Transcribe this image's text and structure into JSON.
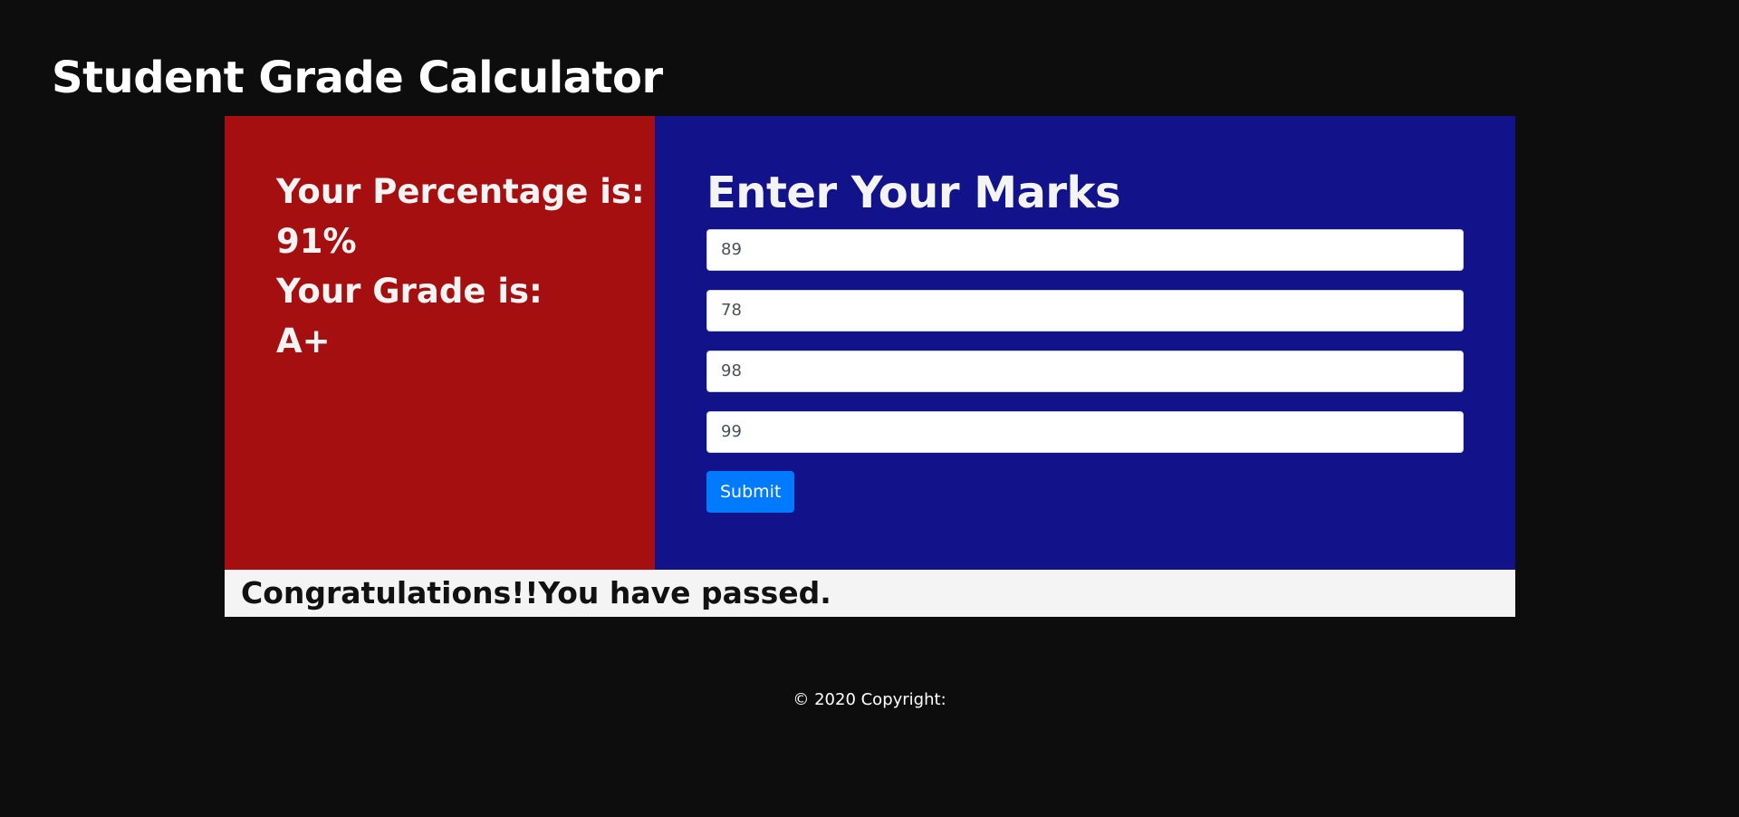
{
  "header": {
    "title": "Student Grade Calculator"
  },
  "result": {
    "percentage_label": "Your Percentage is:",
    "percentage_value": "91%",
    "grade_label": "Your Grade is:",
    "grade_value": "A+"
  },
  "form": {
    "heading": "Enter Your Marks",
    "marks": [
      "89",
      "78",
      "98",
      "99"
    ],
    "submit_label": "Submit"
  },
  "message": {
    "text": "Congratulations!!You have passed."
  },
  "footer": {
    "text": "© 2020 Copyright:"
  },
  "colors": {
    "background": "#0d0d0d",
    "result_panel": "#a60f0f",
    "form_panel": "#12128a",
    "submit_button": "#007bff",
    "message_bar": "#f4f4f4"
  }
}
